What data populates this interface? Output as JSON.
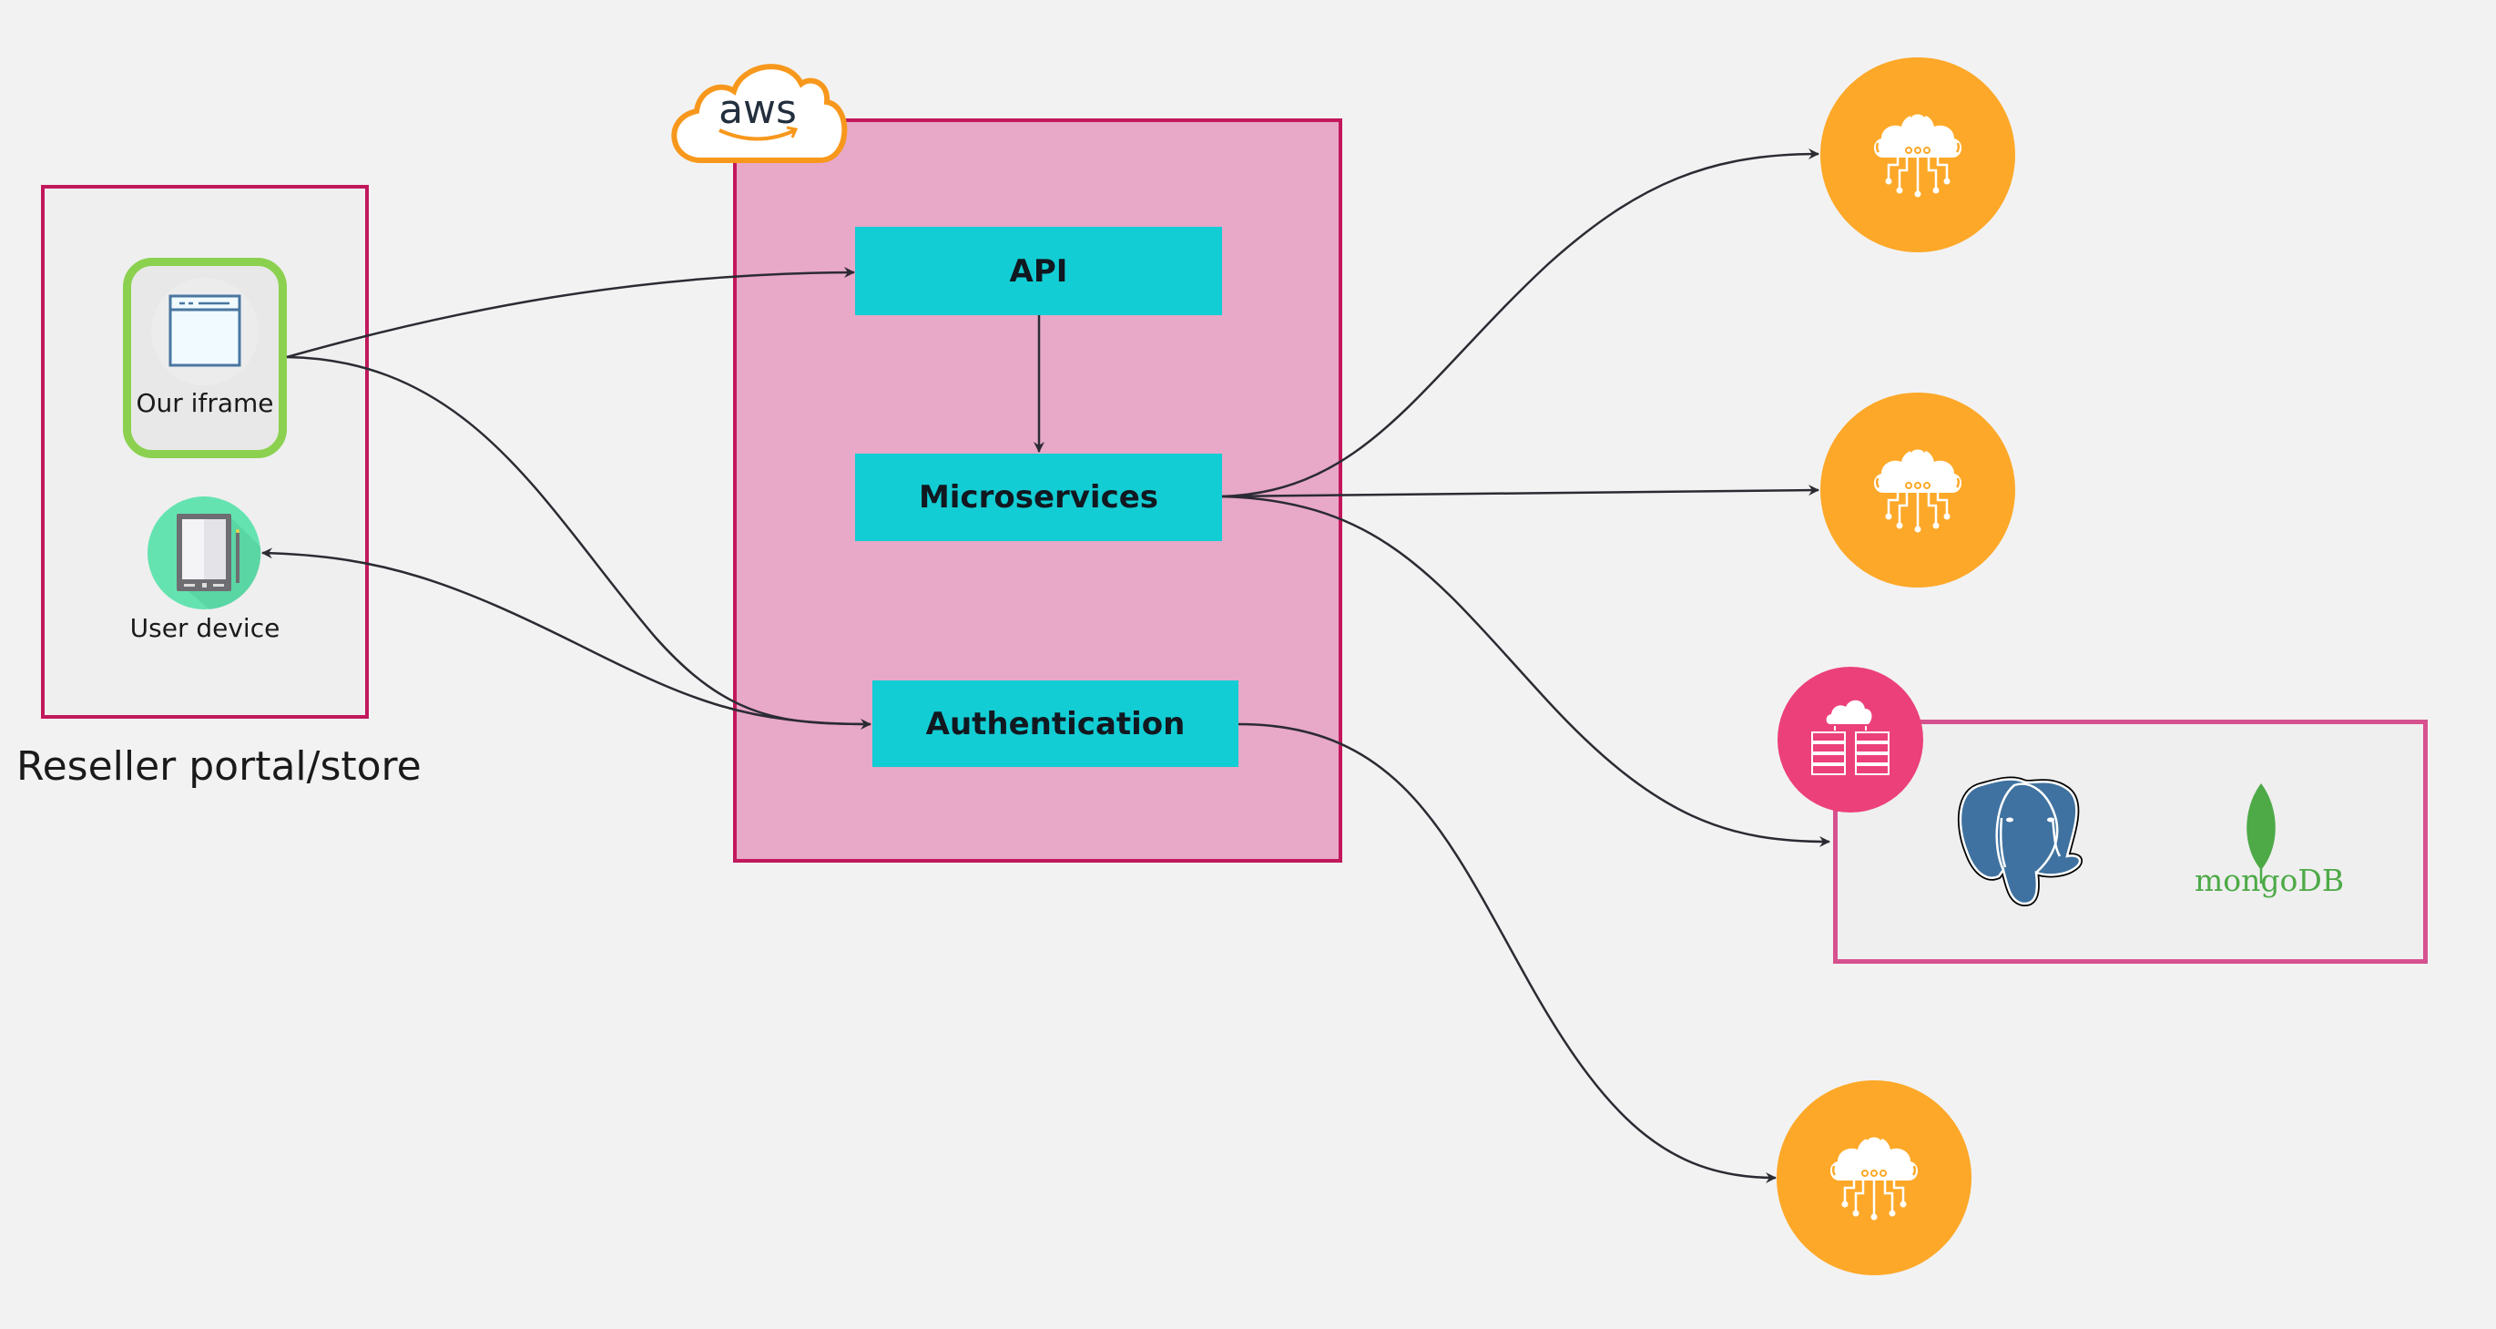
{
  "diagram": {
    "groups": {
      "reseller": {
        "title": "Reseller portal/store"
      },
      "aws": {
        "logo_text": "aws"
      },
      "databases": {
        "items": [
          "postgresql-logo",
          "mongoDB"
        ]
      }
    },
    "nodes": {
      "iframe": {
        "label": "Our iframe",
        "icon": "browser-window-icon"
      },
      "user_device": {
        "label": "User device",
        "icon": "tablet-icon"
      },
      "api": {
        "label": "API"
      },
      "microservices": {
        "label": "Microservices"
      },
      "authentication": {
        "label": "Authentication"
      },
      "cloud_service_1": {
        "icon": "cloud-network-icon"
      },
      "cloud_service_2": {
        "icon": "cloud-network-icon"
      },
      "cloud_service_3": {
        "icon": "cloud-network-icon"
      },
      "db_server": {
        "icon": "cloud-server-icon"
      },
      "mongodb": {
        "label": "mongoDB"
      },
      "postgresql": {
        "icon": "postgresql-elephant-icon"
      }
    },
    "edges": [
      {
        "from": "iframe",
        "to": "api"
      },
      {
        "from": "iframe",
        "to": "authentication"
      },
      {
        "from": "authentication",
        "to": "user_device"
      },
      {
        "from": "api",
        "to": "microservices"
      },
      {
        "from": "microservices",
        "to": "cloud_service_1"
      },
      {
        "from": "microservices",
        "to": "cloud_service_2"
      },
      {
        "from": "microservices",
        "to": "databases"
      },
      {
        "from": "authentication",
        "to": "cloud_service_3"
      }
    ],
    "colors": {
      "group_border": "#c2185b",
      "aws_fill": "#e8a8c8",
      "service_box": "#13cdd4",
      "cloud_circle": "#fda828",
      "db_circle": "#ec407a",
      "db_border": "#d6518f",
      "iframe_border": "#8bd14f",
      "device_circle": "#64e3b0",
      "aws_orange": "#f7981d",
      "mongo_green": "#4daa47",
      "postgres_blue": "#336791"
    }
  }
}
